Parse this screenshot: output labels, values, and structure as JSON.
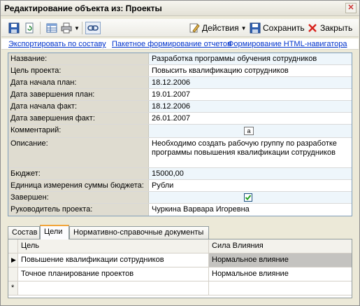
{
  "window": {
    "title": "Редактирование объекта из: Проекты"
  },
  "toolbar": {
    "actions_label": "Действия",
    "save_label": "Сохранить",
    "close_label": "Закрыть"
  },
  "links": [
    "Экспортировать по составу",
    "Пакетное формирование отчетов",
    "Формирование HTML-навигатора"
  ],
  "properties": [
    {
      "label": "Название:",
      "value": "Разработка программы обучения сотрудников"
    },
    {
      "label": "Цель проекта:",
      "value": "Повысить квалификацию сотрудников"
    },
    {
      "label": "Дата начала план:",
      "value": "18.12.2006"
    },
    {
      "label": "Дата завершения план:",
      "value": "19.01.2007"
    },
    {
      "label": "Дата начала факт:",
      "value": "18.12.2006"
    },
    {
      "label": "Дата завершения факт:",
      "value": "26.01.2007"
    },
    {
      "label": "Комментарий:",
      "value": ""
    },
    {
      "label": "Описание:",
      "value": "Необходимо создать рабочую группу по разработке программы повышения квалификации сотрудников"
    },
    {
      "label": "Бюджет:",
      "value": "15000,00"
    },
    {
      "label": "Единица измерения суммы бюджета:",
      "value": "Рубли"
    },
    {
      "label": "Завершен:",
      "value": "",
      "checked": true
    },
    {
      "label": "Руководитель проекта:",
      "value": "Чуркина Варвара Игоревна"
    }
  ],
  "tabs": [
    {
      "label": "Состав"
    },
    {
      "label": "Цели",
      "active": true
    },
    {
      "label": "Нормативно-справочные документы"
    }
  ],
  "grid": {
    "columns": [
      "Цель",
      "Сила Влияния"
    ],
    "rows": [
      {
        "goal": "Повышение квалификации сотрудников",
        "impact": "Нормальное влияние",
        "selected": true
      },
      {
        "goal": "Точное планирование проектов",
        "impact": "Нормальное влияние"
      }
    ],
    "new_row_marker": "*"
  }
}
